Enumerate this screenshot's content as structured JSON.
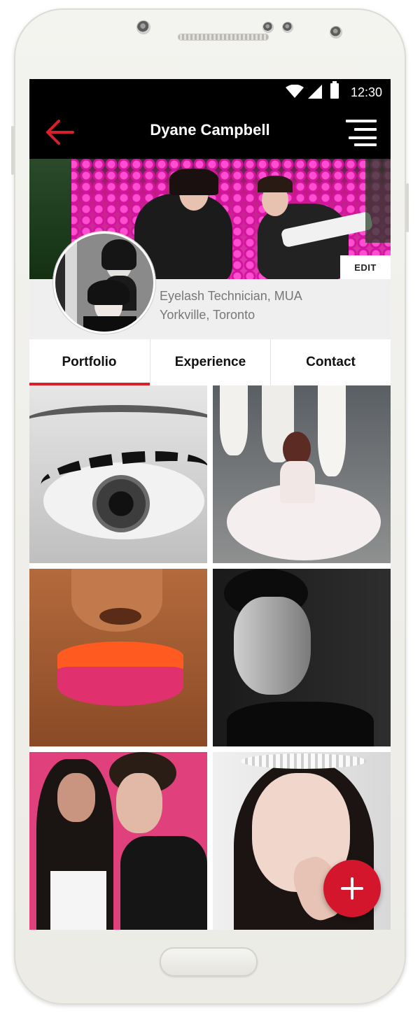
{
  "status_bar": {
    "time": "12:30"
  },
  "app_bar": {
    "title": "Dyane Campbell"
  },
  "profile": {
    "edit_label": "EDIT",
    "title_line": "Eyelash Technician, MUA",
    "location": "Yorkville, Toronto"
  },
  "tabs": [
    {
      "label": "Portfolio",
      "active": true
    },
    {
      "label": "Experience",
      "active": false
    },
    {
      "label": "Contact",
      "active": false
    }
  ],
  "portfolio": {
    "items": [
      {
        "subject": "eyelash close-up"
      },
      {
        "subject": "bride in gown"
      },
      {
        "subject": "lips close-up"
      },
      {
        "subject": "black-and-white portrait"
      },
      {
        "subject": "couple portrait"
      },
      {
        "subject": "bridal headpiece portrait"
      }
    ]
  },
  "colors": {
    "accent": "#d8202a",
    "fab": "#d3162b",
    "app_bar": "#000000"
  },
  "icons": {
    "back": "arrow-left-icon",
    "menu": "menu-icon",
    "fab": "plus-icon"
  }
}
